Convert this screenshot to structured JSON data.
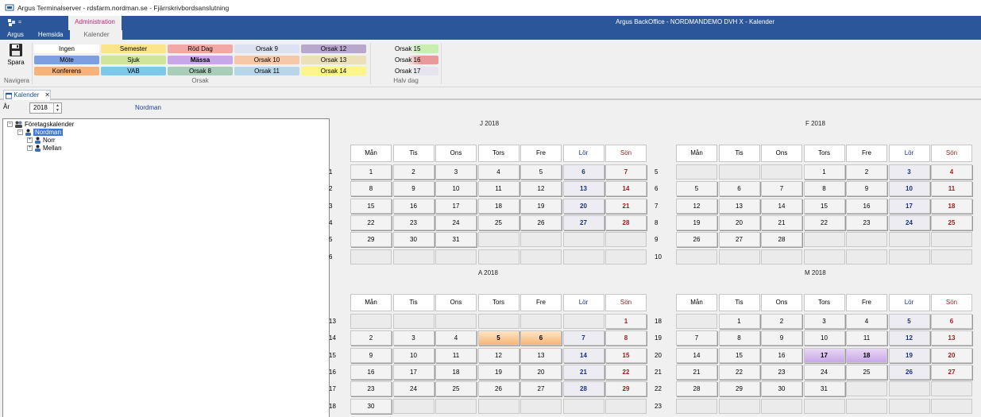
{
  "window": {
    "title": "Argus Terminalserver - rdsfarm.nordman.se - Fjärrskrivbordsanslutning"
  },
  "app": {
    "title": "Argus BackOffice - NORDMANDEMO DVH X - Kalender",
    "context_group": "Administration"
  },
  "tabs": [
    "Argus",
    "Hemsida",
    "Kalender"
  ],
  "ribbon": {
    "save_label": "Spara",
    "navigate_group": "Navigera",
    "orsak_group": "Orsak",
    "halfday_group": "Halv dag",
    "orsak_buttons": [
      {
        "label": "Ingen",
        "color": "#ffffff"
      },
      {
        "label": "Möte",
        "color": "#7b9fe0"
      },
      {
        "label": "Konferens",
        "color": "#f7b27a"
      },
      {
        "label": "Semester",
        "color": "#fbe58b"
      },
      {
        "label": "Sjuk",
        "color": "#cfe59a"
      },
      {
        "label": "VAB",
        "color": "#7ec8ec"
      },
      {
        "label": "Röd Dag",
        "color": "#f3a8a8"
      },
      {
        "label": "Mässa",
        "color": "#c8a7e8"
      },
      {
        "label": "Orsak 8",
        "color": "#a8cdb8"
      },
      {
        "label": "Orsak 9",
        "color": "#dde2f2"
      },
      {
        "label": "Orsak 10",
        "color": "#f6c8a8"
      },
      {
        "label": "Orsak 11",
        "color": "#b8d6ea"
      },
      {
        "label": "Orsak 12",
        "color": "#b7a8cc"
      },
      {
        "label": "Orsak 13",
        "color": "#ece0b8"
      },
      {
        "label": "Orsak 14",
        "color": "#fdf58a"
      }
    ],
    "halfday_buttons": [
      {
        "label": "Orsak 15",
        "color": "#c8eeb0"
      },
      {
        "label": "Orsak 16",
        "color": "#e89a9a"
      },
      {
        "label": "Orsak 17",
        "color": "#e6e4ee"
      }
    ]
  },
  "document_tab": {
    "label": "Kalender"
  },
  "year": {
    "label": "År",
    "value": "2018"
  },
  "user_name": "Nordman",
  "tree": {
    "root": "Företagskalender",
    "selected": "Nordman",
    "children": [
      "Norr",
      "Mellan"
    ]
  },
  "weekdays": [
    "Mån",
    "Tis",
    "Ons",
    "Tors",
    "Fre",
    "Lör",
    "Sön"
  ],
  "months": [
    {
      "title": "J 2018",
      "weeks": [
        "1",
        "2",
        "3",
        "4",
        "5",
        "6"
      ],
      "days": [
        [
          "1",
          "2",
          "3",
          "4",
          "5",
          "6",
          "7"
        ],
        [
          "8",
          "9",
          "10",
          "11",
          "12",
          "13",
          "14"
        ],
        [
          "15",
          "16",
          "17",
          "18",
          "19",
          "20",
          "21"
        ],
        [
          "22",
          "23",
          "24",
          "25",
          "26",
          "27",
          "28"
        ],
        [
          "29",
          "30",
          "31",
          "",
          "",
          "",
          ""
        ],
        [
          "",
          "",
          "",
          "",
          "",
          "",
          ""
        ]
      ]
    },
    {
      "title": "F 2018",
      "weeks": [
        "5",
        "6",
        "7",
        "8",
        "9",
        "10"
      ],
      "days": [
        [
          "",
          "",
          "",
          "1",
          "2",
          "3",
          "4"
        ],
        [
          "5",
          "6",
          "7",
          "8",
          "9",
          "10",
          "11"
        ],
        [
          "12",
          "13",
          "14",
          "15",
          "16",
          "17",
          "18"
        ],
        [
          "19",
          "20",
          "21",
          "22",
          "23",
          "24",
          "25"
        ],
        [
          "26",
          "27",
          "28",
          "",
          "",
          "",
          ""
        ],
        [
          "",
          "",
          "",
          "",
          "",
          "",
          ""
        ]
      ]
    },
    {
      "title": "A 2018",
      "weeks": [
        "13",
        "14",
        "15",
        "16",
        "17",
        "18"
      ],
      "days": [
        [
          "",
          "",
          "",
          "",
          "",
          "",
          "1"
        ],
        [
          "2",
          "3",
          "4",
          "5",
          "6",
          "7",
          "8"
        ],
        [
          "9",
          "10",
          "11",
          "12",
          "13",
          "14",
          "15"
        ],
        [
          "16",
          "17",
          "18",
          "19",
          "20",
          "21",
          "22"
        ],
        [
          "23",
          "24",
          "25",
          "26",
          "27",
          "28",
          "29"
        ],
        [
          "30",
          "",
          "",
          "",
          "",
          "",
          ""
        ]
      ],
      "marked": {
        "Konferens": [
          "5",
          "6"
        ]
      }
    },
    {
      "title": "M 2018",
      "weeks": [
        "18",
        "19",
        "20",
        "21",
        "22",
        "23"
      ],
      "days": [
        [
          "",
          "1",
          "2",
          "3",
          "4",
          "5",
          "6"
        ],
        [
          "7",
          "8",
          "9",
          "10",
          "11",
          "12",
          "13"
        ],
        [
          "14",
          "15",
          "16",
          "17",
          "18",
          "19",
          "20"
        ],
        [
          "21",
          "22",
          "23",
          "24",
          "25",
          "26",
          "27"
        ],
        [
          "28",
          "29",
          "30",
          "31",
          "",
          "",
          ""
        ],
        [
          "",
          "",
          "",
          "",
          "",
          "",
          ""
        ]
      ],
      "marked": {
        "Mässa": [
          "17",
          "18"
        ]
      }
    }
  ]
}
